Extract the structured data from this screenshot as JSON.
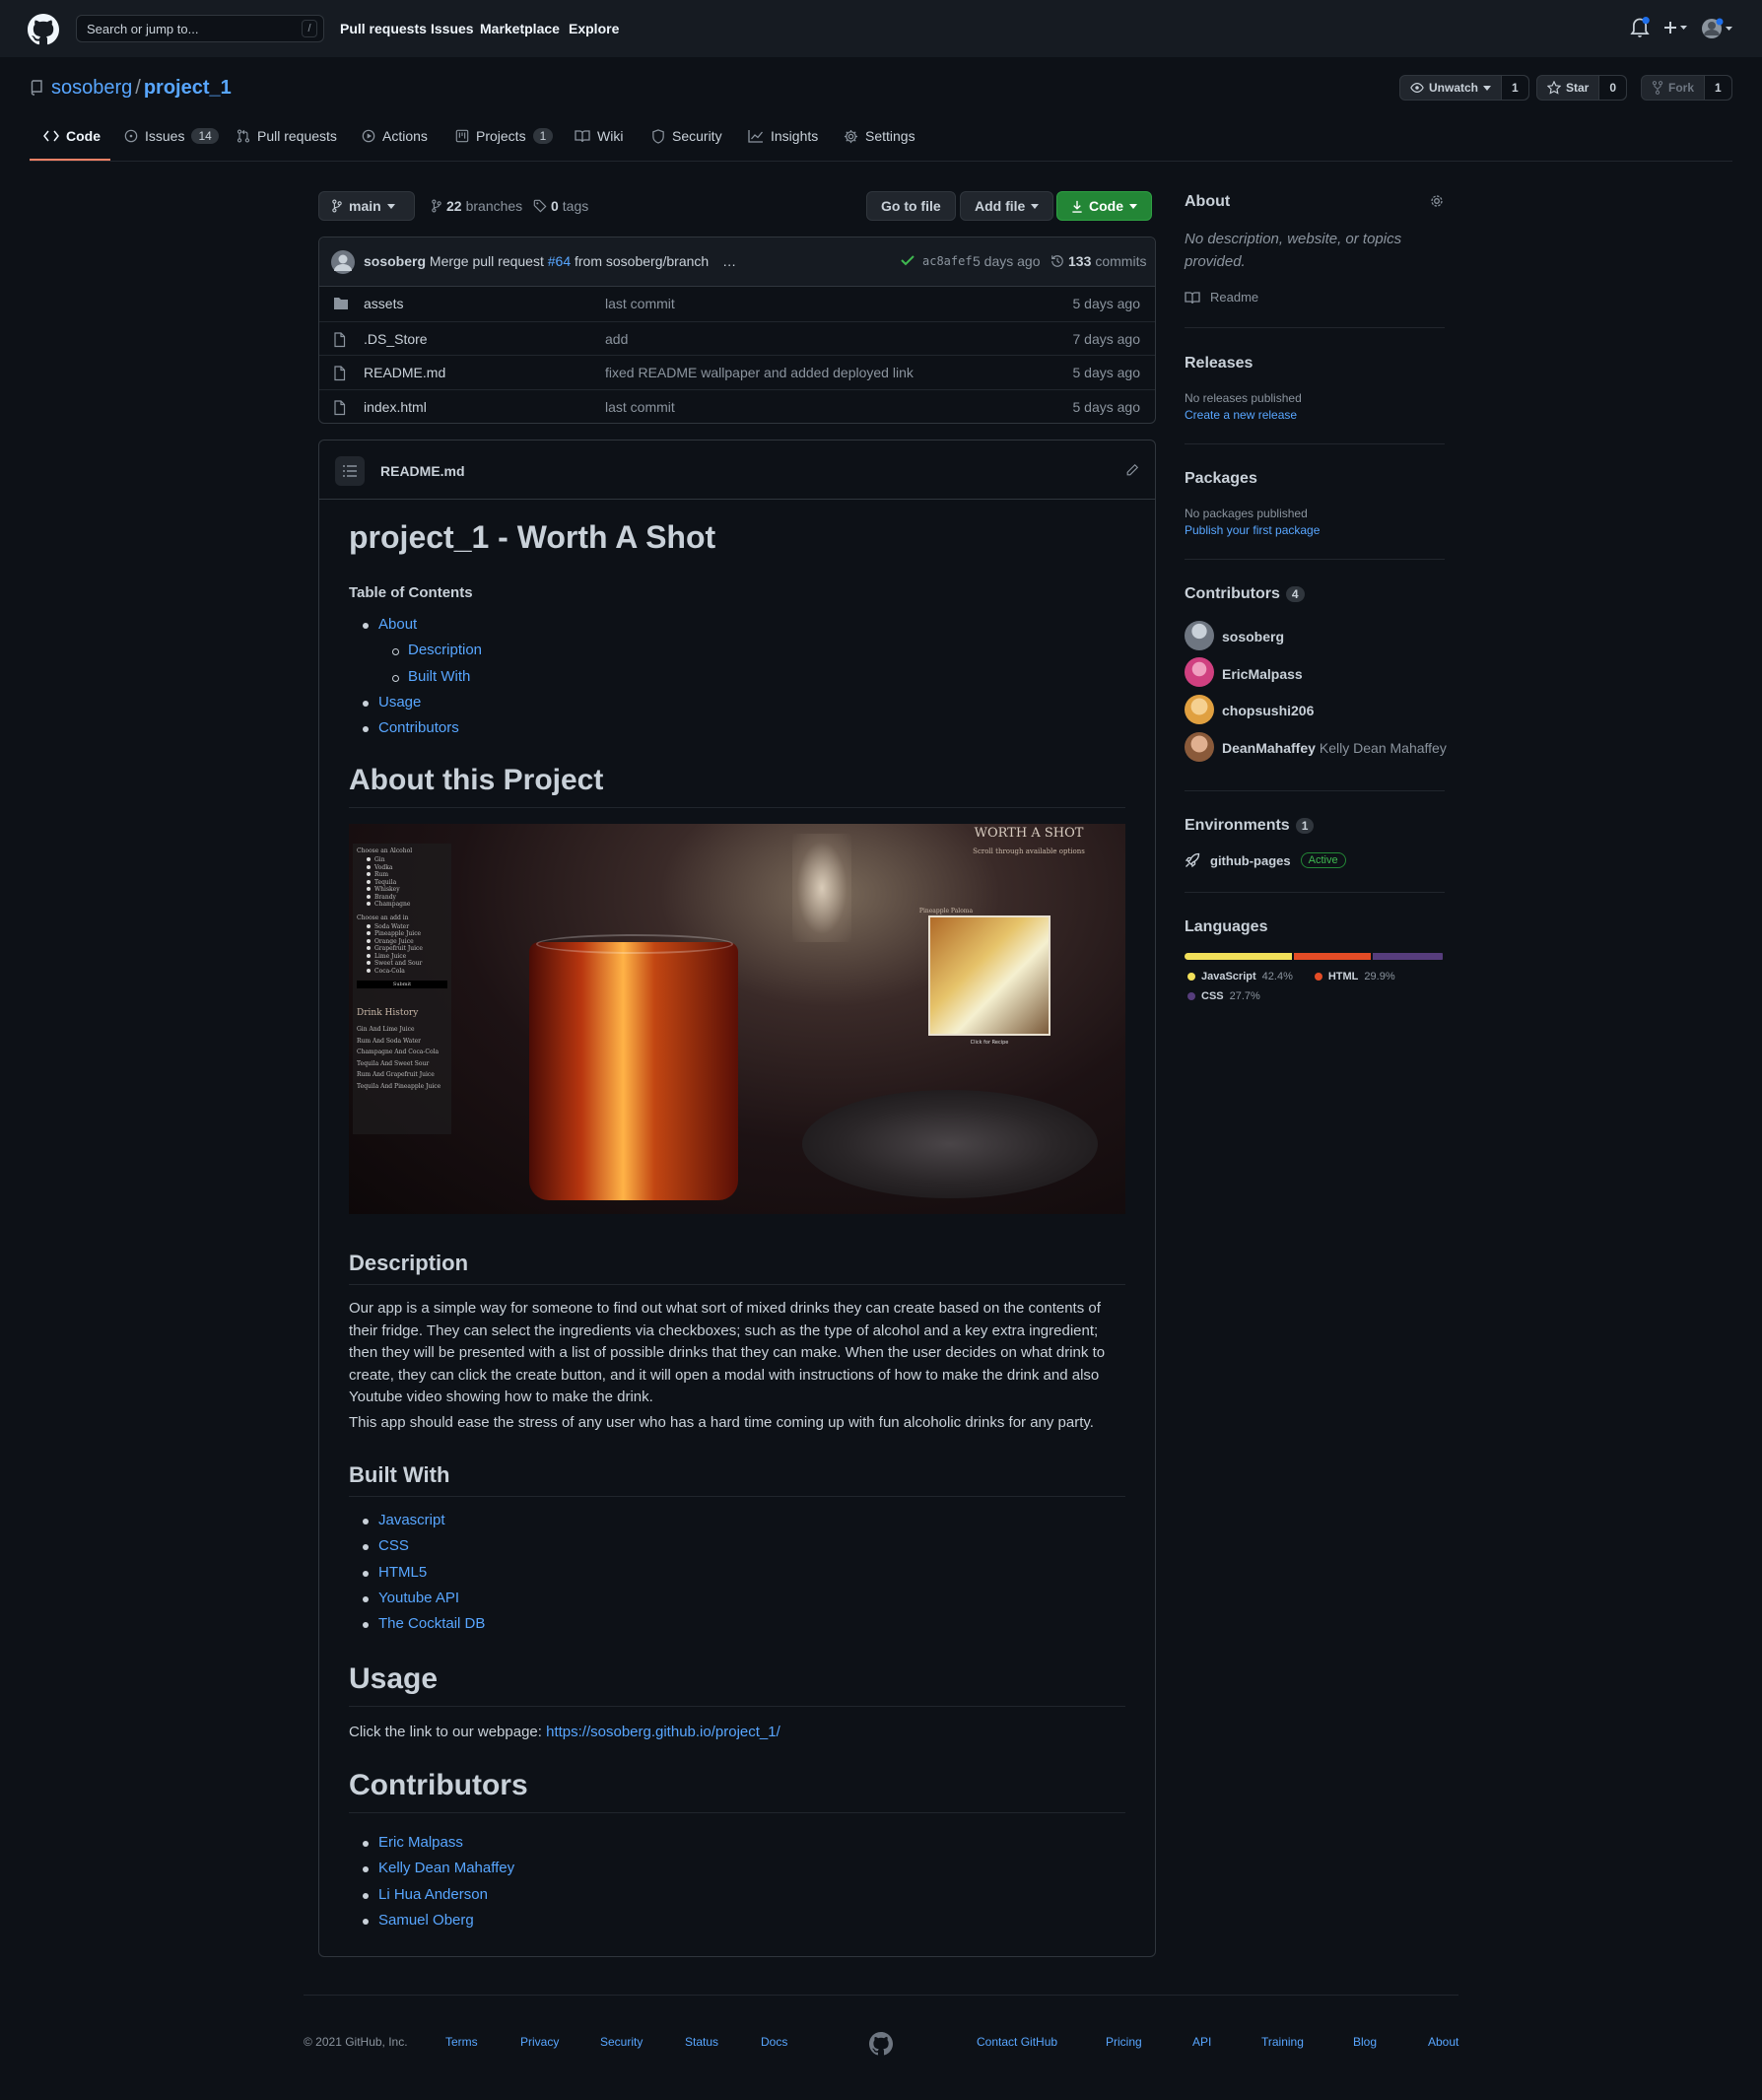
{
  "header": {
    "search_placeholder": "Search or jump to...",
    "search_key": "/",
    "nav": [
      "Pull requests",
      "Issues",
      "Marketplace",
      "Explore"
    ]
  },
  "repo": {
    "owner": "sosoberg",
    "name": "project_1",
    "watch": {
      "label": "Unwatch",
      "count": "1"
    },
    "star": {
      "label": "Star",
      "count": "0"
    },
    "fork": {
      "label": "Fork",
      "count": "1"
    }
  },
  "tabs": [
    {
      "label": "Code"
    },
    {
      "label": "Issues",
      "count": "14"
    },
    {
      "label": "Pull requests"
    },
    {
      "label": "Actions"
    },
    {
      "label": "Projects",
      "count": "1"
    },
    {
      "label": "Wiki"
    },
    {
      "label": "Security"
    },
    {
      "label": "Insights"
    },
    {
      "label": "Settings"
    }
  ],
  "toolbar": {
    "branch": "main",
    "branches_count": "22",
    "branches_label": "branches",
    "tags_count": "0",
    "tags_label": "tags",
    "go_to_file": "Go to file",
    "add_file": "Add file",
    "code": "Code"
  },
  "commit": {
    "author": "sosoberg",
    "message_pre": "Merge pull request",
    "pr": "#64",
    "message_post": "from sosoberg/branch",
    "ellipsis": "…",
    "sha": "ac8afef",
    "age": "5 days ago",
    "commits_count": "133",
    "commits_label": "commits"
  },
  "files": [
    {
      "name": "assets",
      "message": "last commit",
      "age": "5 days ago",
      "type": "dir"
    },
    {
      "name": ".DS_Store",
      "message": "add",
      "age": "7 days ago",
      "type": "file"
    },
    {
      "name": "README.md",
      "message": "fixed README wallpaper and added deployed link",
      "age": "5 days ago",
      "type": "file"
    },
    {
      "name": "index.html",
      "message": "last commit",
      "age": "5 days ago",
      "type": "file"
    }
  ],
  "readme": {
    "filename": "README.md",
    "title": "project_1 - Worth A Shot",
    "toc_heading": "Table of Contents",
    "toc": [
      "About",
      "Description",
      "Built With",
      "Usage",
      "Contributors"
    ],
    "about_heading": "About this Project",
    "screenshot": {
      "title": "WORTH A SHOT",
      "subtitle": "Scroll through available options",
      "alcohol_label": "Choose an Alcohol",
      "alcohols": [
        "Gin",
        "Vodka",
        "Rum",
        "Tequila",
        "Whiskey",
        "Brandy",
        "Champagne"
      ],
      "mixer_label": "Choose an add in",
      "mixers": [
        "Soda Water",
        "Pineapple Juice",
        "Orange Juice",
        "Grapefruit Juice",
        "Lime Juice",
        "Sweet and Sour",
        "Coca-Cola"
      ],
      "submit": "Submit",
      "history_label": "Drink History",
      "history": [
        "Gin And Lime Juice",
        "Rum And Soda Water",
        "Champagne And Coca-Cola",
        "Tequila And Sweet Sour",
        "Rum And Grapefruit Juice",
        "Tequila And Pineapple Juice"
      ],
      "card_title": "Pineapple Paloma",
      "card_link": "Click for Recipe"
    },
    "description_heading": "Description",
    "description_p1": "Our app is a simple way for someone to find out what sort of mixed drinks they can create based on the contents of their fridge. They can select the ingredients via checkboxes; such as the type of alcohol and a key extra ingredient; then they will be presented with a list of possible drinks that they can make. When the user decides on what drink to create, they can click the create button, and it will open a modal with instructions of how to make the drink and also Youtube video showing how to make the drink.",
    "description_p2": "This app should ease the stress of any user who has a hard time coming up with fun alcoholic drinks for any party.",
    "built_heading": "Built With",
    "built": [
      "Javascript",
      "CSS",
      "HTML5",
      "Youtube API",
      "The Cocktail DB"
    ],
    "usage_heading": "Usage",
    "usage_text": "Click the link to our webpage:",
    "usage_link": "https://sosoberg.github.io/project_1/",
    "contributors_heading": "Contributors",
    "contributors": [
      "Eric Malpass",
      "Kelly Dean Mahaffey",
      "Li Hua Anderson",
      "Samuel Oberg"
    ]
  },
  "sidebar": {
    "about_heading": "About",
    "about_text": "No description, website, or topics provided.",
    "readme_label": "Readme",
    "releases_heading": "Releases",
    "releases_text": "No releases published",
    "releases_link": "Create a new release",
    "packages_heading": "Packages",
    "packages_text": "No packages published",
    "packages_link": "Publish your first package",
    "contributors_heading": "Contributors",
    "contributors_count": "4",
    "contributors": [
      {
        "login": "sosoberg",
        "name": ""
      },
      {
        "login": "EricMalpass",
        "name": ""
      },
      {
        "login": "chopsushi206",
        "name": ""
      },
      {
        "login": "DeanMahaffey",
        "name": "Kelly Dean Mahaffey"
      }
    ],
    "environments_heading": "Environments",
    "environments_count": "1",
    "environment": "github-pages",
    "environment_status": "Active",
    "languages_heading": "Languages",
    "languages": [
      {
        "name": "JavaScript",
        "percent": "42.4%",
        "value": 42.4,
        "color": "#f1e05a"
      },
      {
        "name": "HTML",
        "percent": "29.9%",
        "value": 29.9,
        "color": "#e34c26"
      },
      {
        "name": "CSS",
        "percent": "27.7%",
        "value": 27.7,
        "color": "#563d7c"
      }
    ]
  },
  "footer": {
    "copyright": "© 2021 GitHub, Inc.",
    "left_links": [
      "Terms",
      "Privacy",
      "Security",
      "Status",
      "Docs"
    ],
    "right_links": [
      "Contact GitHub",
      "Pricing",
      "API",
      "Training",
      "Blog",
      "About"
    ]
  }
}
